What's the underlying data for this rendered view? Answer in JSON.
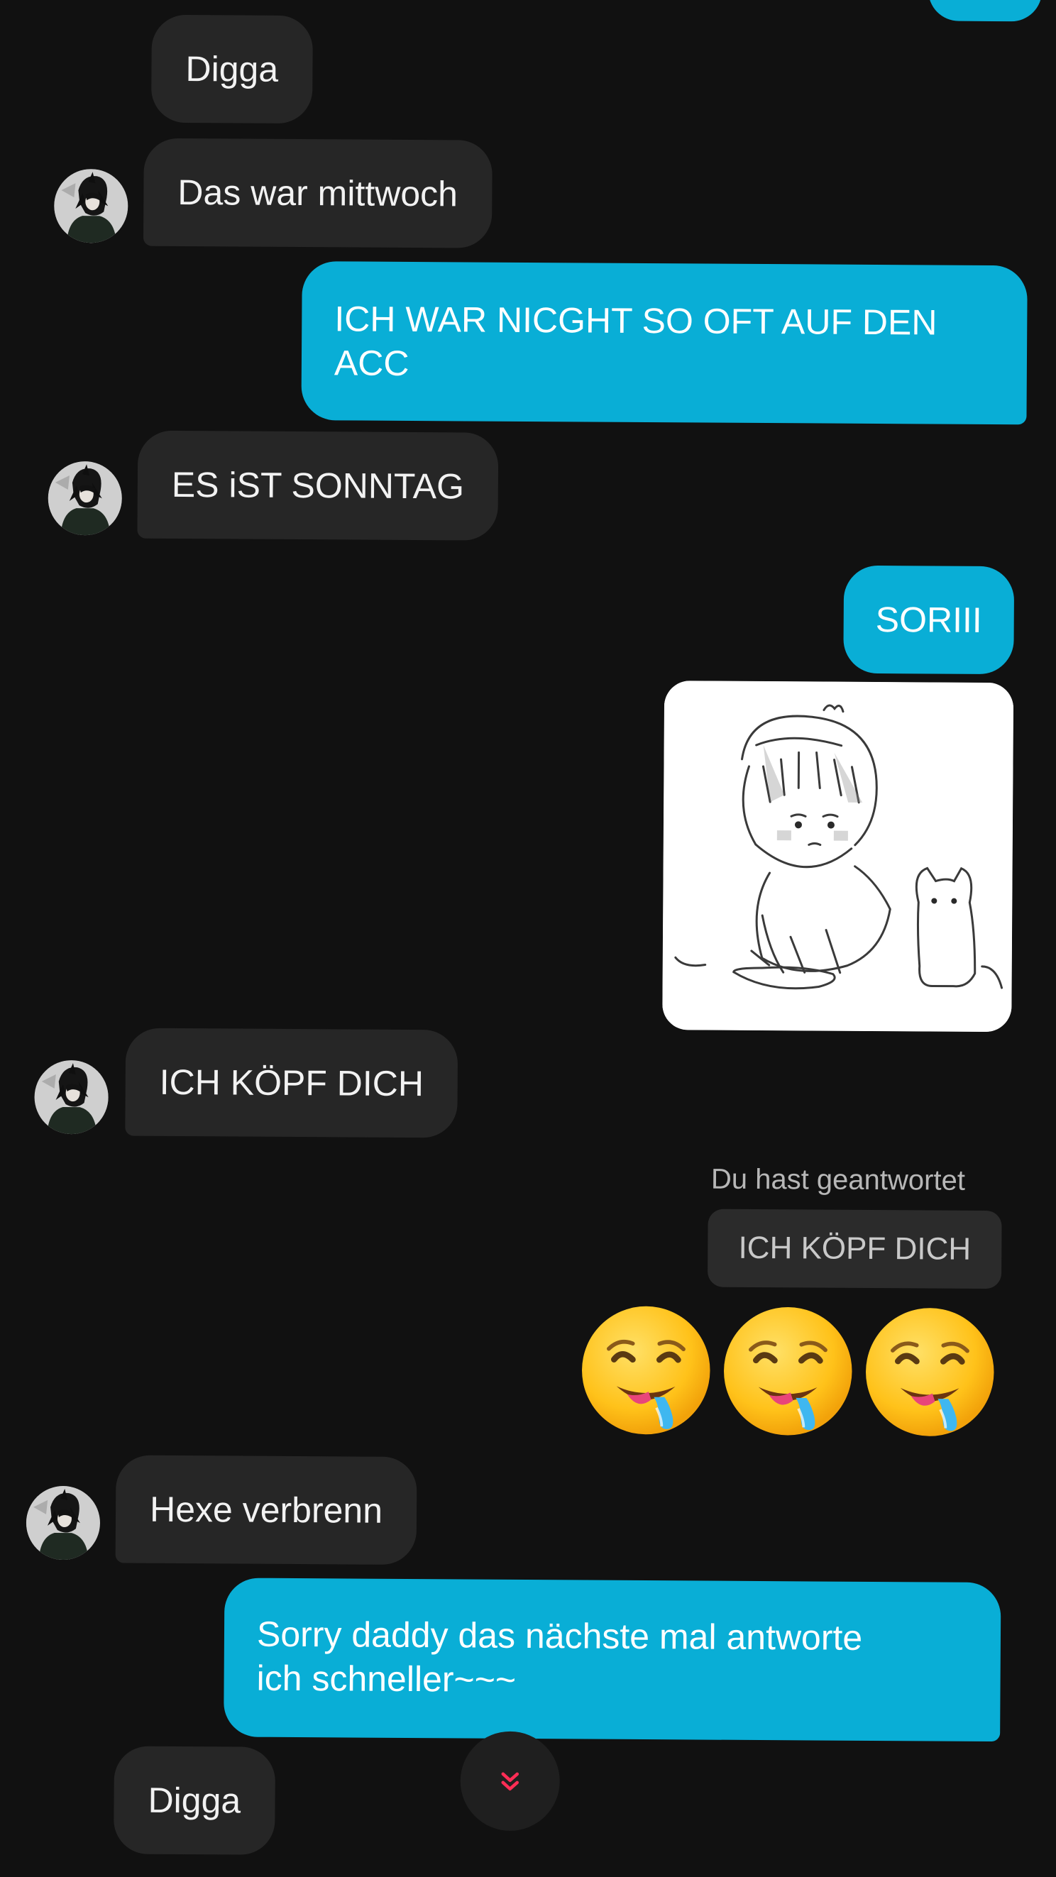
{
  "messages": [
    {
      "id": "m1",
      "side": "in",
      "text": "Digga"
    },
    {
      "id": "m2",
      "side": "in",
      "text": "Das war mittwoch"
    },
    {
      "id": "m3",
      "side": "out",
      "lines": [
        "ICH WAR NICGHT SO OFT AUF DEN",
        "ACC"
      ]
    },
    {
      "id": "m4",
      "side": "in",
      "text": "ES iST SONNTAG"
    },
    {
      "id": "m5",
      "side": "out",
      "text": "SORIII"
    },
    {
      "id": "m6",
      "side": "out",
      "type": "sticker",
      "description": "sketch-sad-kid-with-cat"
    },
    {
      "id": "m7",
      "side": "in",
      "text": "ICH KÖPF DICH"
    },
    {
      "id": "m8",
      "side": "out",
      "type": "reply",
      "reply_label": "Du hast geantwortet",
      "quoted": "ICH KÖPF DICH"
    },
    {
      "id": "m9",
      "side": "out",
      "type": "emoji",
      "emoji": [
        "drooling-face",
        "drooling-face",
        "drooling-face"
      ]
    },
    {
      "id": "m10",
      "side": "in",
      "text": "Hexe verbrenn"
    },
    {
      "id": "m11",
      "side": "out",
      "lines": [
        "Sorry daddy das nächste mal antworte",
        "ich schneller~~~"
      ]
    },
    {
      "id": "m12",
      "side": "in",
      "text": "Digga"
    }
  ],
  "colors": {
    "background": "#111111",
    "incoming_bubble": "#262626",
    "outgoing_bubble": "#09aed6",
    "scroll_chevron": "#ff2d55"
  },
  "scroll_button": {
    "icon": "double-chevron-down-icon"
  }
}
